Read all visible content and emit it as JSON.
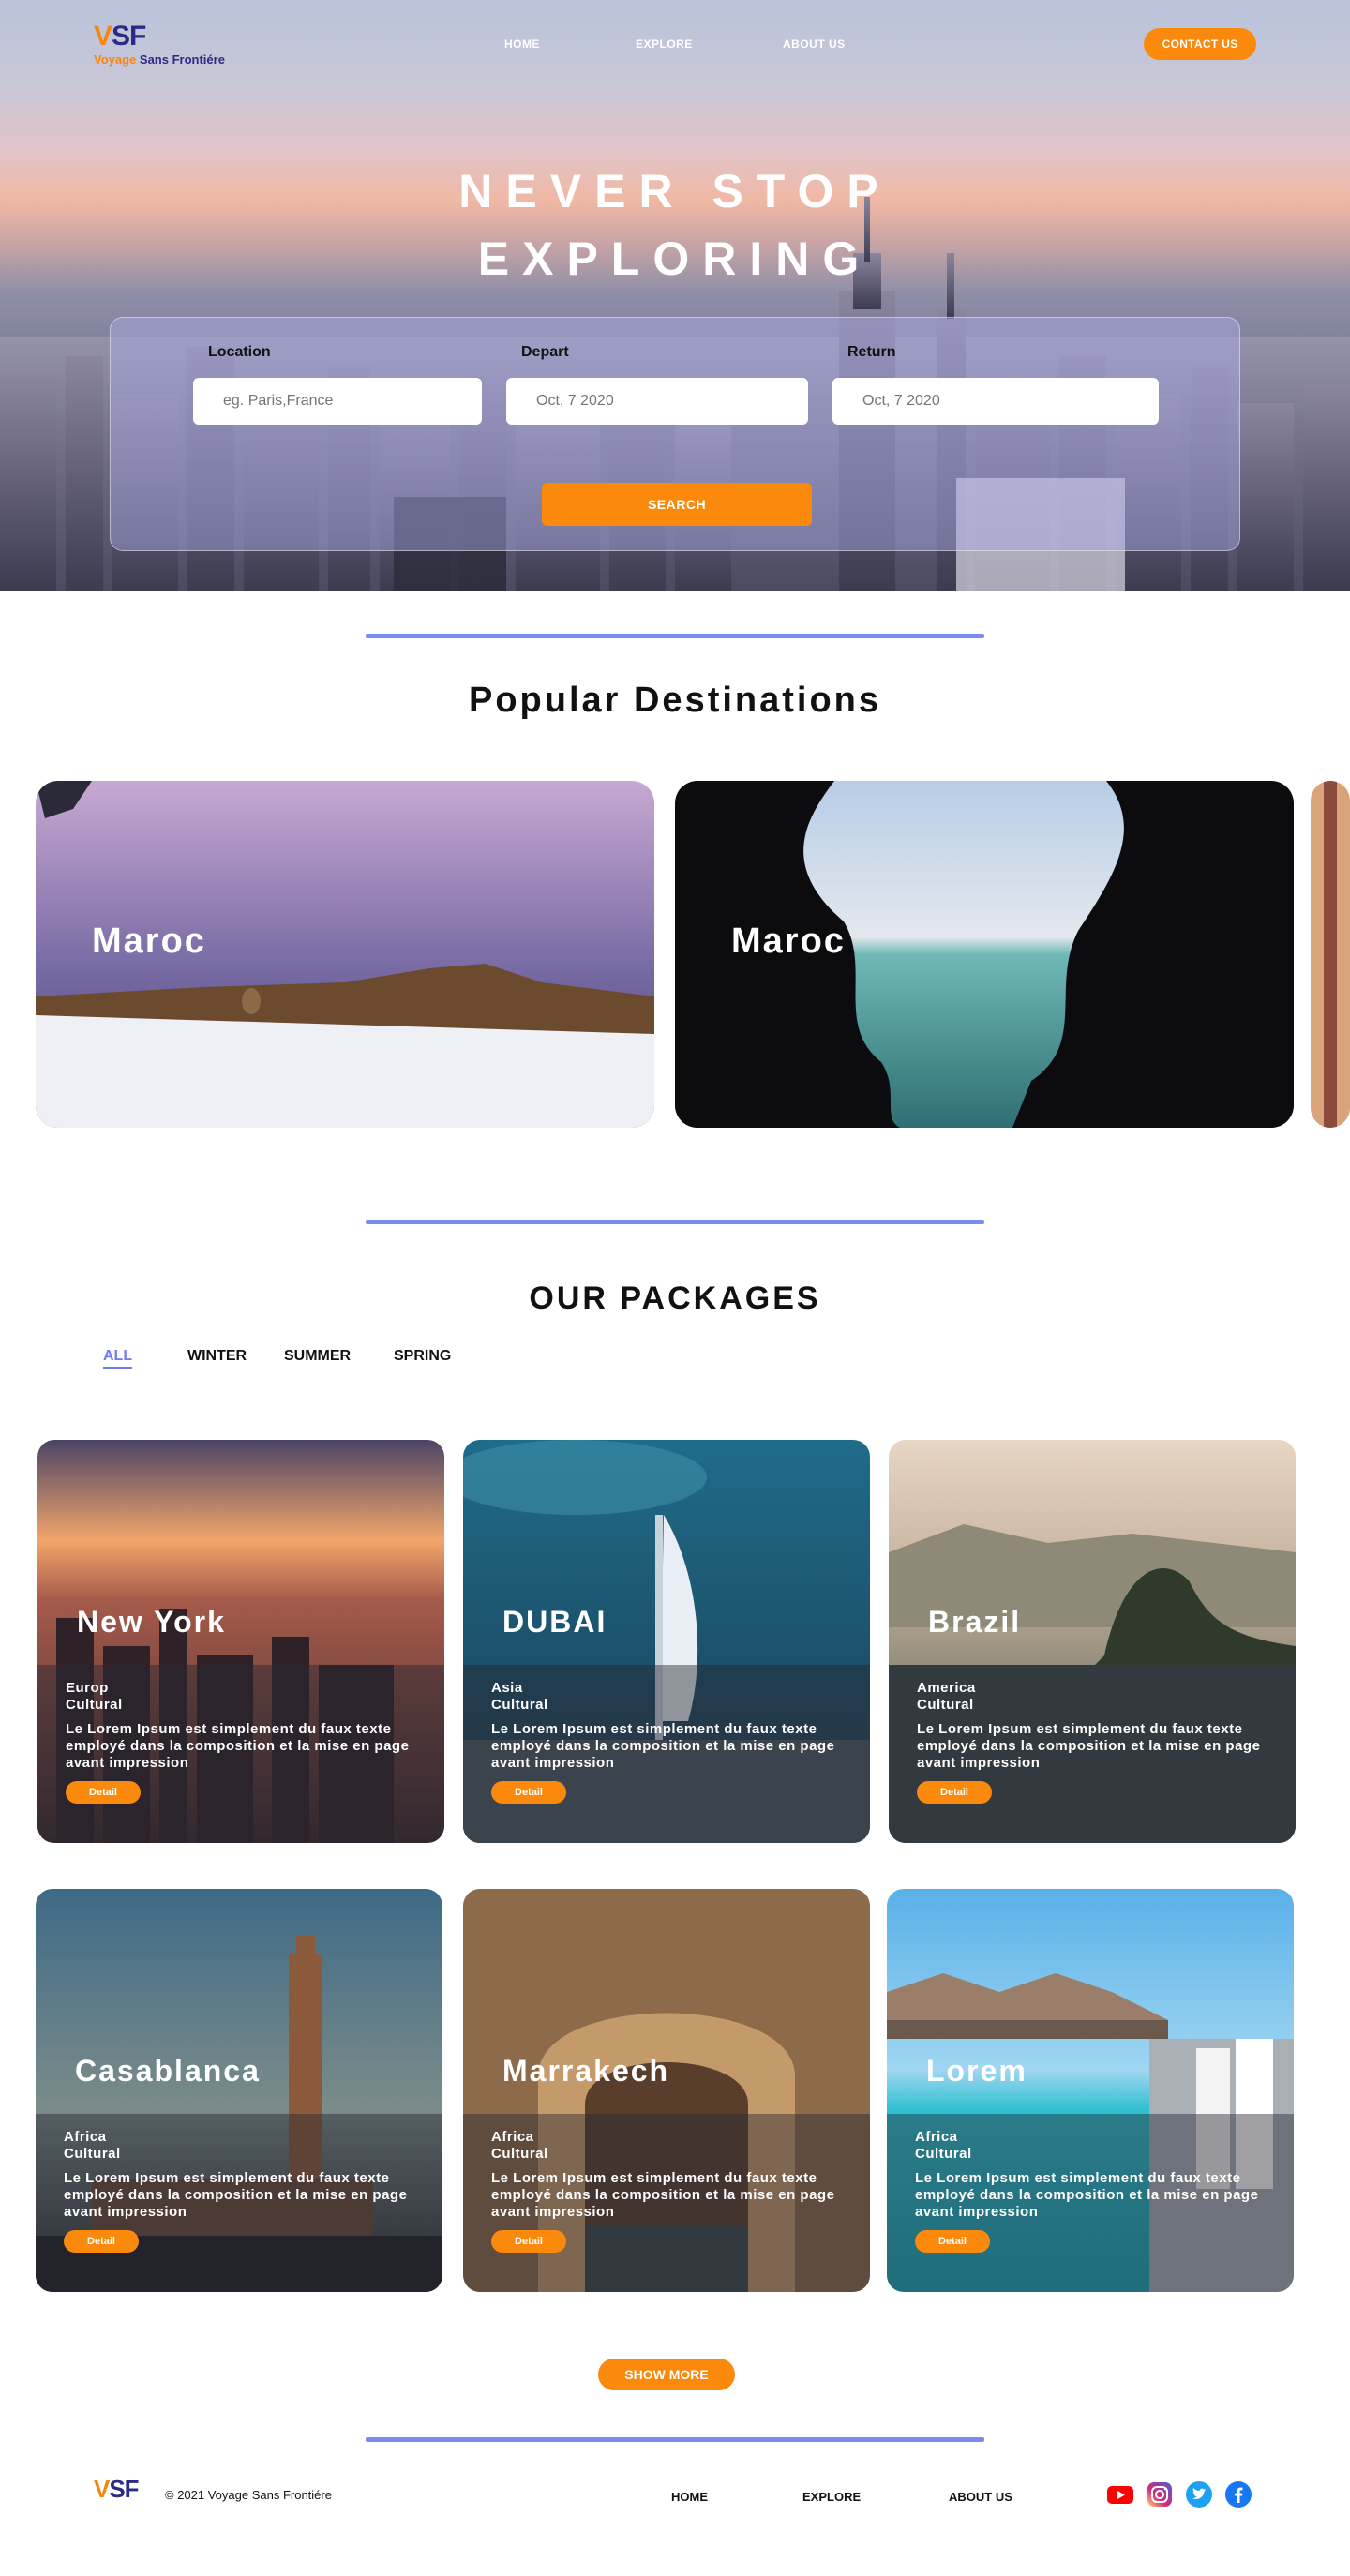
{
  "brand": {
    "logo_v": "V",
    "logo_sf": "SF",
    "name_part1": "Voyage",
    "name_part2": "Sans Frontiére"
  },
  "nav": {
    "home": "HOME",
    "explore": "EXPLORE",
    "about": "ABOUT US",
    "contact": "CONTACT US"
  },
  "hero": {
    "title_line1": "NEVER STOP",
    "title_line2": "EXPLORING",
    "location_label": "Location",
    "location_placeholder": "eg. Paris,France",
    "depart_label": "Depart",
    "depart_placeholder": "Oct, 7 2020",
    "return_label": "Return",
    "return_placeholder": "Oct, 7 2020",
    "search_label": "SEARCH"
  },
  "popular": {
    "title": "Popular Destinations",
    "cards": [
      {
        "label": "Maroc"
      },
      {
        "label": "Maroc"
      }
    ]
  },
  "packages": {
    "title": "OUR PACKAGES",
    "tabs": [
      "ALL",
      "WINTER",
      "SUMMER",
      "SPRING"
    ],
    "active_tab": "ALL",
    "items": [
      {
        "name": "New York",
        "region": "Europ",
        "type": "Cultural",
        "desc": "Le Lorem Ipsum est simplement du faux texte employé dans la composition et la mise en page avant impression",
        "button": "Detail"
      },
      {
        "name": "DUBAI",
        "region": "Asia",
        "type": "Cultural",
        "desc": "Le Lorem Ipsum est simplement du faux texte employé dans la composition et la mise en page avant impression",
        "button": "Detail"
      },
      {
        "name": "Brazil",
        "region": "America",
        "type": "Cultural",
        "desc": "Le Lorem Ipsum est simplement du faux texte employé dans la composition et la mise en page avant impression",
        "button": "Detail"
      },
      {
        "name": "Casablanca",
        "region": "Africa",
        "type": "Cultural",
        "desc": "Le Lorem Ipsum est simplement du faux texte employé dans la composition et la mise en page avant impression",
        "button": "Detail"
      },
      {
        "name": "Marrakech",
        "region": "Africa",
        "type": "Cultural",
        "desc": "Le Lorem Ipsum est simplement du faux texte employé dans la composition et la mise en page avant impression",
        "button": "Detail"
      },
      {
        "name": "Lorem",
        "region": "Africa",
        "type": "Cultural",
        "desc": "Le Lorem Ipsum est simplement du faux texte employé dans la composition et la mise en page avant impression",
        "button": "Detail"
      }
    ],
    "show_more": "SHOW MORE"
  },
  "footer": {
    "copyright": "© 2021 Voyage Sans Frontiére",
    "home": "HOME",
    "explore": "EXPLORE",
    "about": "ABOUT US",
    "social": [
      "youtube-icon",
      "instagram-icon",
      "twitter-icon",
      "facebook-icon"
    ]
  },
  "colors": {
    "accent": "#fb8a0c",
    "divider": "#7b8cf0",
    "brand_dark": "#2b2a86"
  }
}
